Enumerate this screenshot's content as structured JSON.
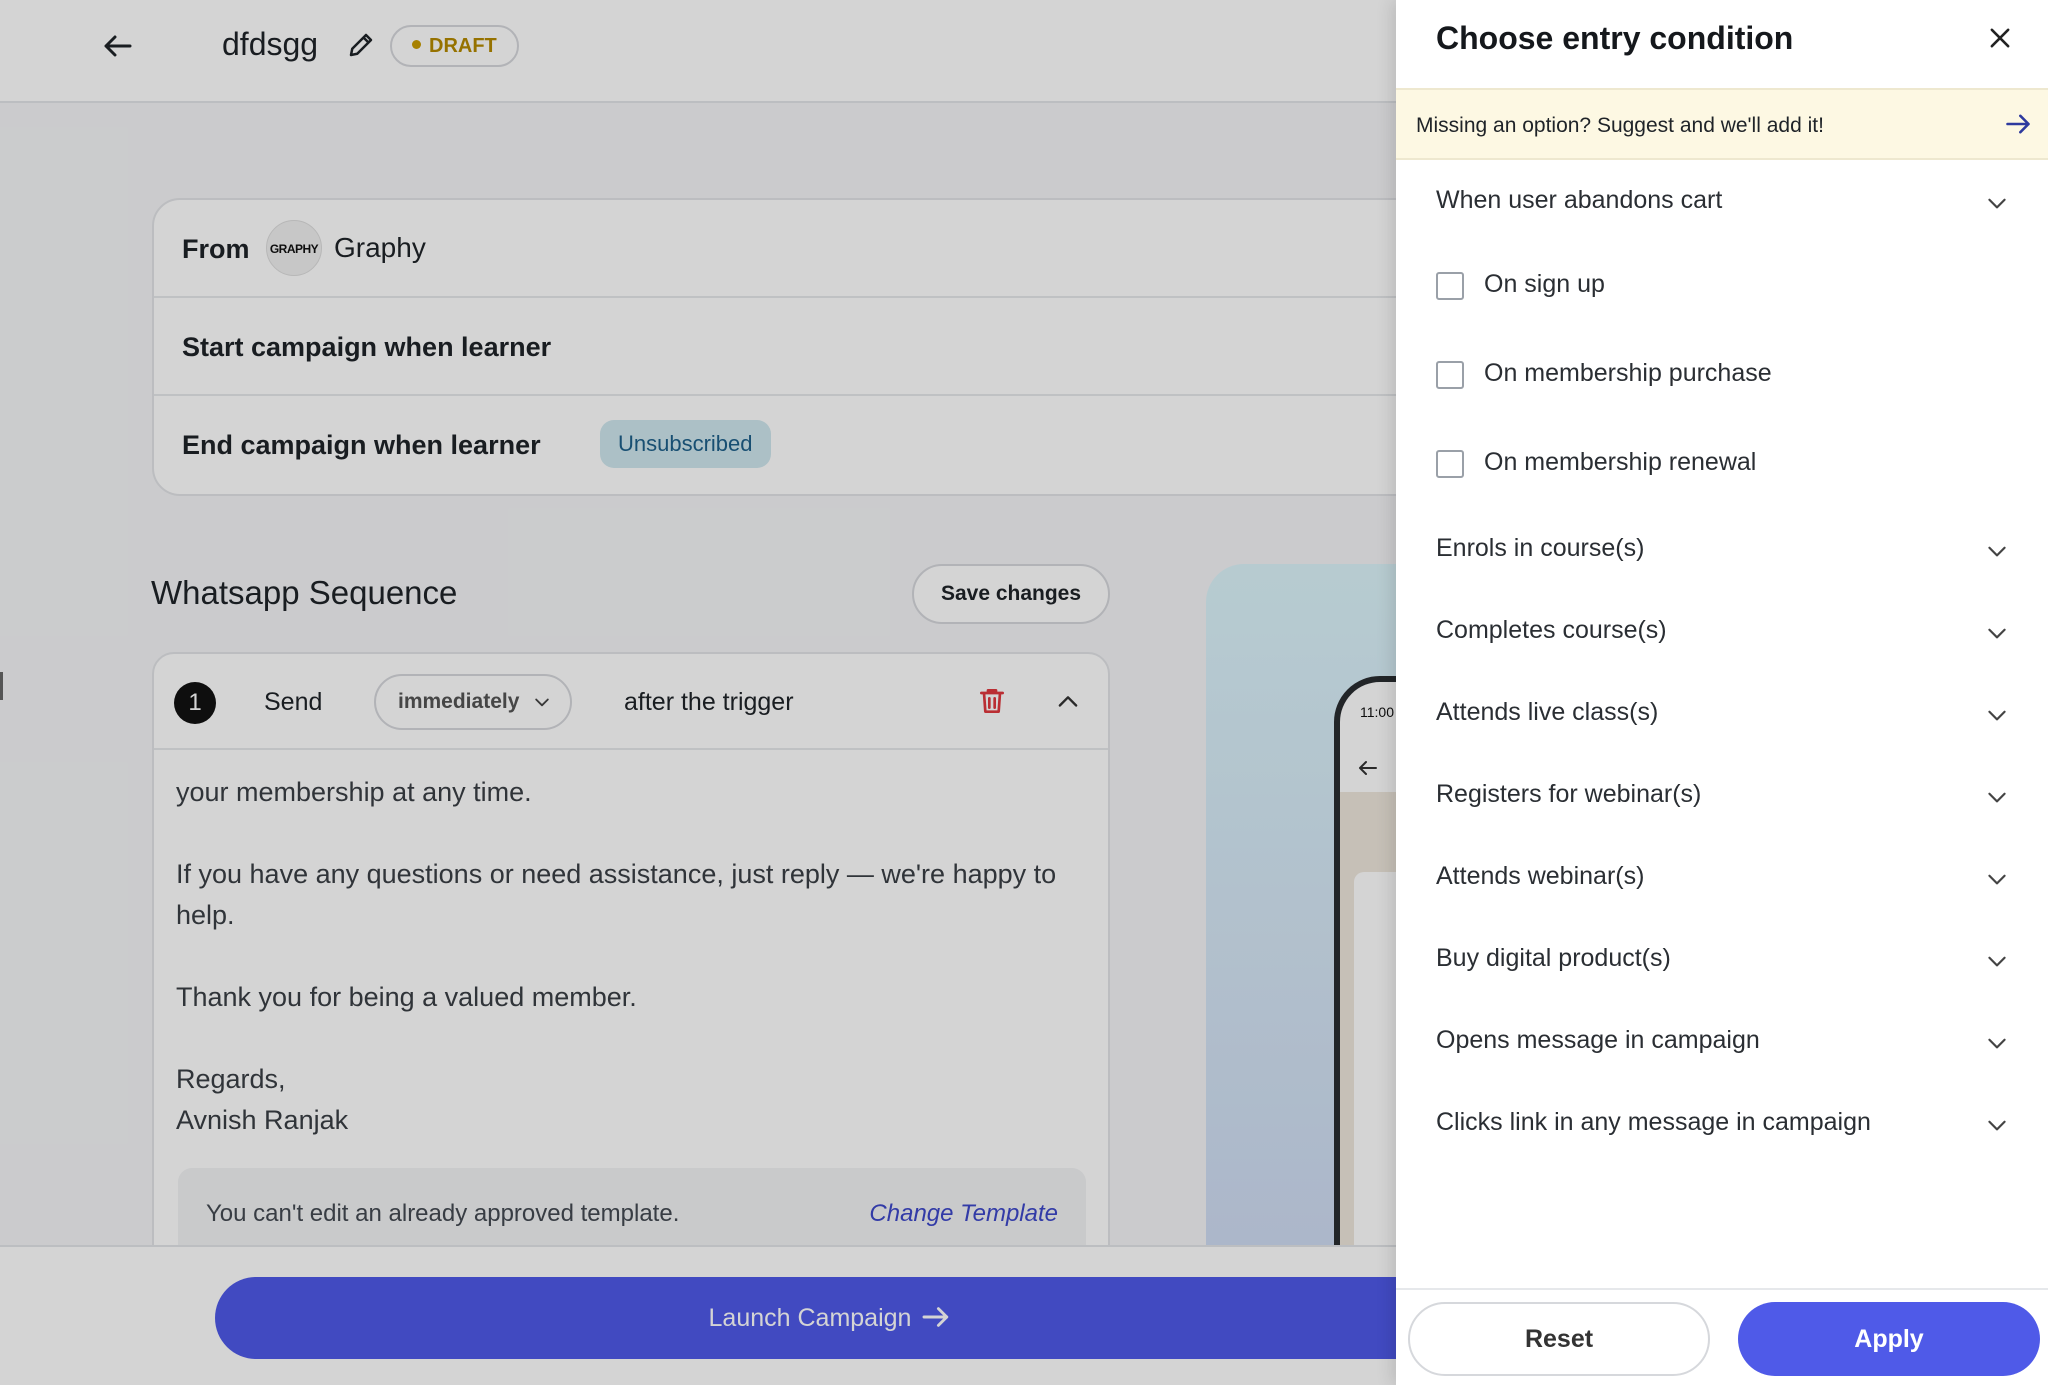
{
  "header": {
    "campaign_name": "dfdsgg",
    "status_badge": "DRAFT"
  },
  "settings": {
    "from_label": "From",
    "from_avatar_text": "GRAPHY",
    "from_name": "Graphy",
    "start_label": "Start campaign when learner",
    "end_label": "End campaign when learner",
    "end_badge": "Unsubscribed"
  },
  "sequence": {
    "title": "Whatsapp Sequence",
    "save_label": "Save changes",
    "step": {
      "number": "1",
      "send_label": "Send",
      "delay_value": "immediately",
      "after_label": "after the trigger",
      "message_lines": [
        "your membership at any time.",
        "If you have any questions or need assistance, just reply — we're happy to help.",
        "Thank you for being a valued member.",
        "Regards,",
        "Avnish Ranjak"
      ],
      "locked_notice": "You can't edit an already approved template.",
      "change_template_label": "Change Template"
    }
  },
  "preview": {
    "time": "11:00"
  },
  "footer": {
    "launch_label": "Launch Campaign"
  },
  "drawer": {
    "title": "Choose entry condition",
    "suggest_text": "Missing an option? Suggest and we'll add it!",
    "expanded_group": "When user abandons cart",
    "checkbox_options": [
      "On sign up",
      "On membership purchase",
      "On membership renewal"
    ],
    "groups": [
      "Enrols in course(s)",
      "Completes course(s)",
      "Attends live class(s)",
      "Registers for webinar(s)",
      "Attends webinar(s)",
      "Buy digital product(s)",
      "Opens message in campaign",
      "Clicks link in any message in campaign"
    ],
    "reset_label": "Reset",
    "apply_label": "Apply"
  },
  "colors": {
    "accent": "#4f5ae8",
    "draft": "#b58a00",
    "link": "#3d47c9",
    "suggest_bg": "#fdf8e3",
    "danger": "#e0383e"
  }
}
